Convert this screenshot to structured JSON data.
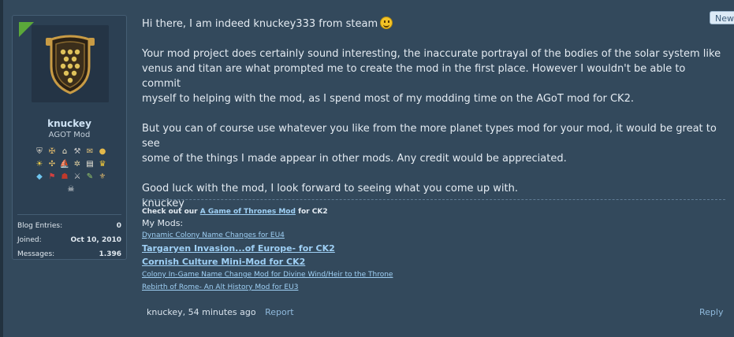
{
  "badge": {
    "new": "New"
  },
  "user": {
    "name": "knuckey",
    "title": "AGOT Mod",
    "stats": [
      {
        "label": "Blog Entries:",
        "value": "0"
      },
      {
        "label": "Joined:",
        "value": "Oct 10, 2010"
      },
      {
        "label": "Messages:",
        "value": "1.396"
      }
    ],
    "trophies": [
      [
        "shield-trophy",
        "sword-trophy",
        "temple-trophy",
        "axes-trophy",
        "scroll-trophy",
        "coin-trophy"
      ],
      [
        "sun-trophy",
        "cross-trophy",
        "ship-trophy",
        "compass-trophy",
        "book-trophy",
        "crown-trophy"
      ],
      [
        "diamond-trophy",
        "flag-trophy",
        "helmet-trophy",
        "swords-trophy",
        "quill-trophy",
        "sword-shield-trophy"
      ],
      [
        "skull-trophy"
      ]
    ]
  },
  "message": {
    "p1": "Hi there, I am indeed knuckey333 from steam",
    "p2a": "Your mod project does certainly sound interesting, the inaccurate portrayal of the bodies of the solar system like",
    "p2b": "venus and titan are what prompted me to create the mod in the first place. However I wouldn't be able to commit",
    "p2c": "myself to helping with the mod, as I spend most of my modding time on the AGoT mod for CK2.",
    "p3a": "But you can of course use whatever you like from the more planet types mod for your mod, it would be great to see",
    "p3b": "some of the things I made appear in other mods. Any credit would be appreciated.",
    "p4": "Good luck with the mod, I look forward to seeing what you come up with.",
    "p5": "knuckey"
  },
  "signature": {
    "prefix": "Check out our",
    "link": "A Game of Thrones Mod",
    "suffix": "for CK2",
    "mymods_label": "My Mods:",
    "mods": [
      {
        "label": "Dynamic Colony Name Changes for EU4",
        "size": "small"
      },
      {
        "label": "Targaryen Invasion...of Europe- for CK2",
        "size": "big"
      },
      {
        "label": "Cornish Culture Mini-Mod for CK2",
        "size": "big"
      },
      {
        "label": "Colony In-Game Name Change Mod for Divine Wind/Heir to the Throne",
        "size": "small"
      },
      {
        "label": "Rebirth of Rome- An Alt History Mod for EU3",
        "size": "small"
      }
    ]
  },
  "footer": {
    "author_time": "knuckey, 54 minutes ago",
    "report": "Report",
    "reply": "Reply"
  }
}
